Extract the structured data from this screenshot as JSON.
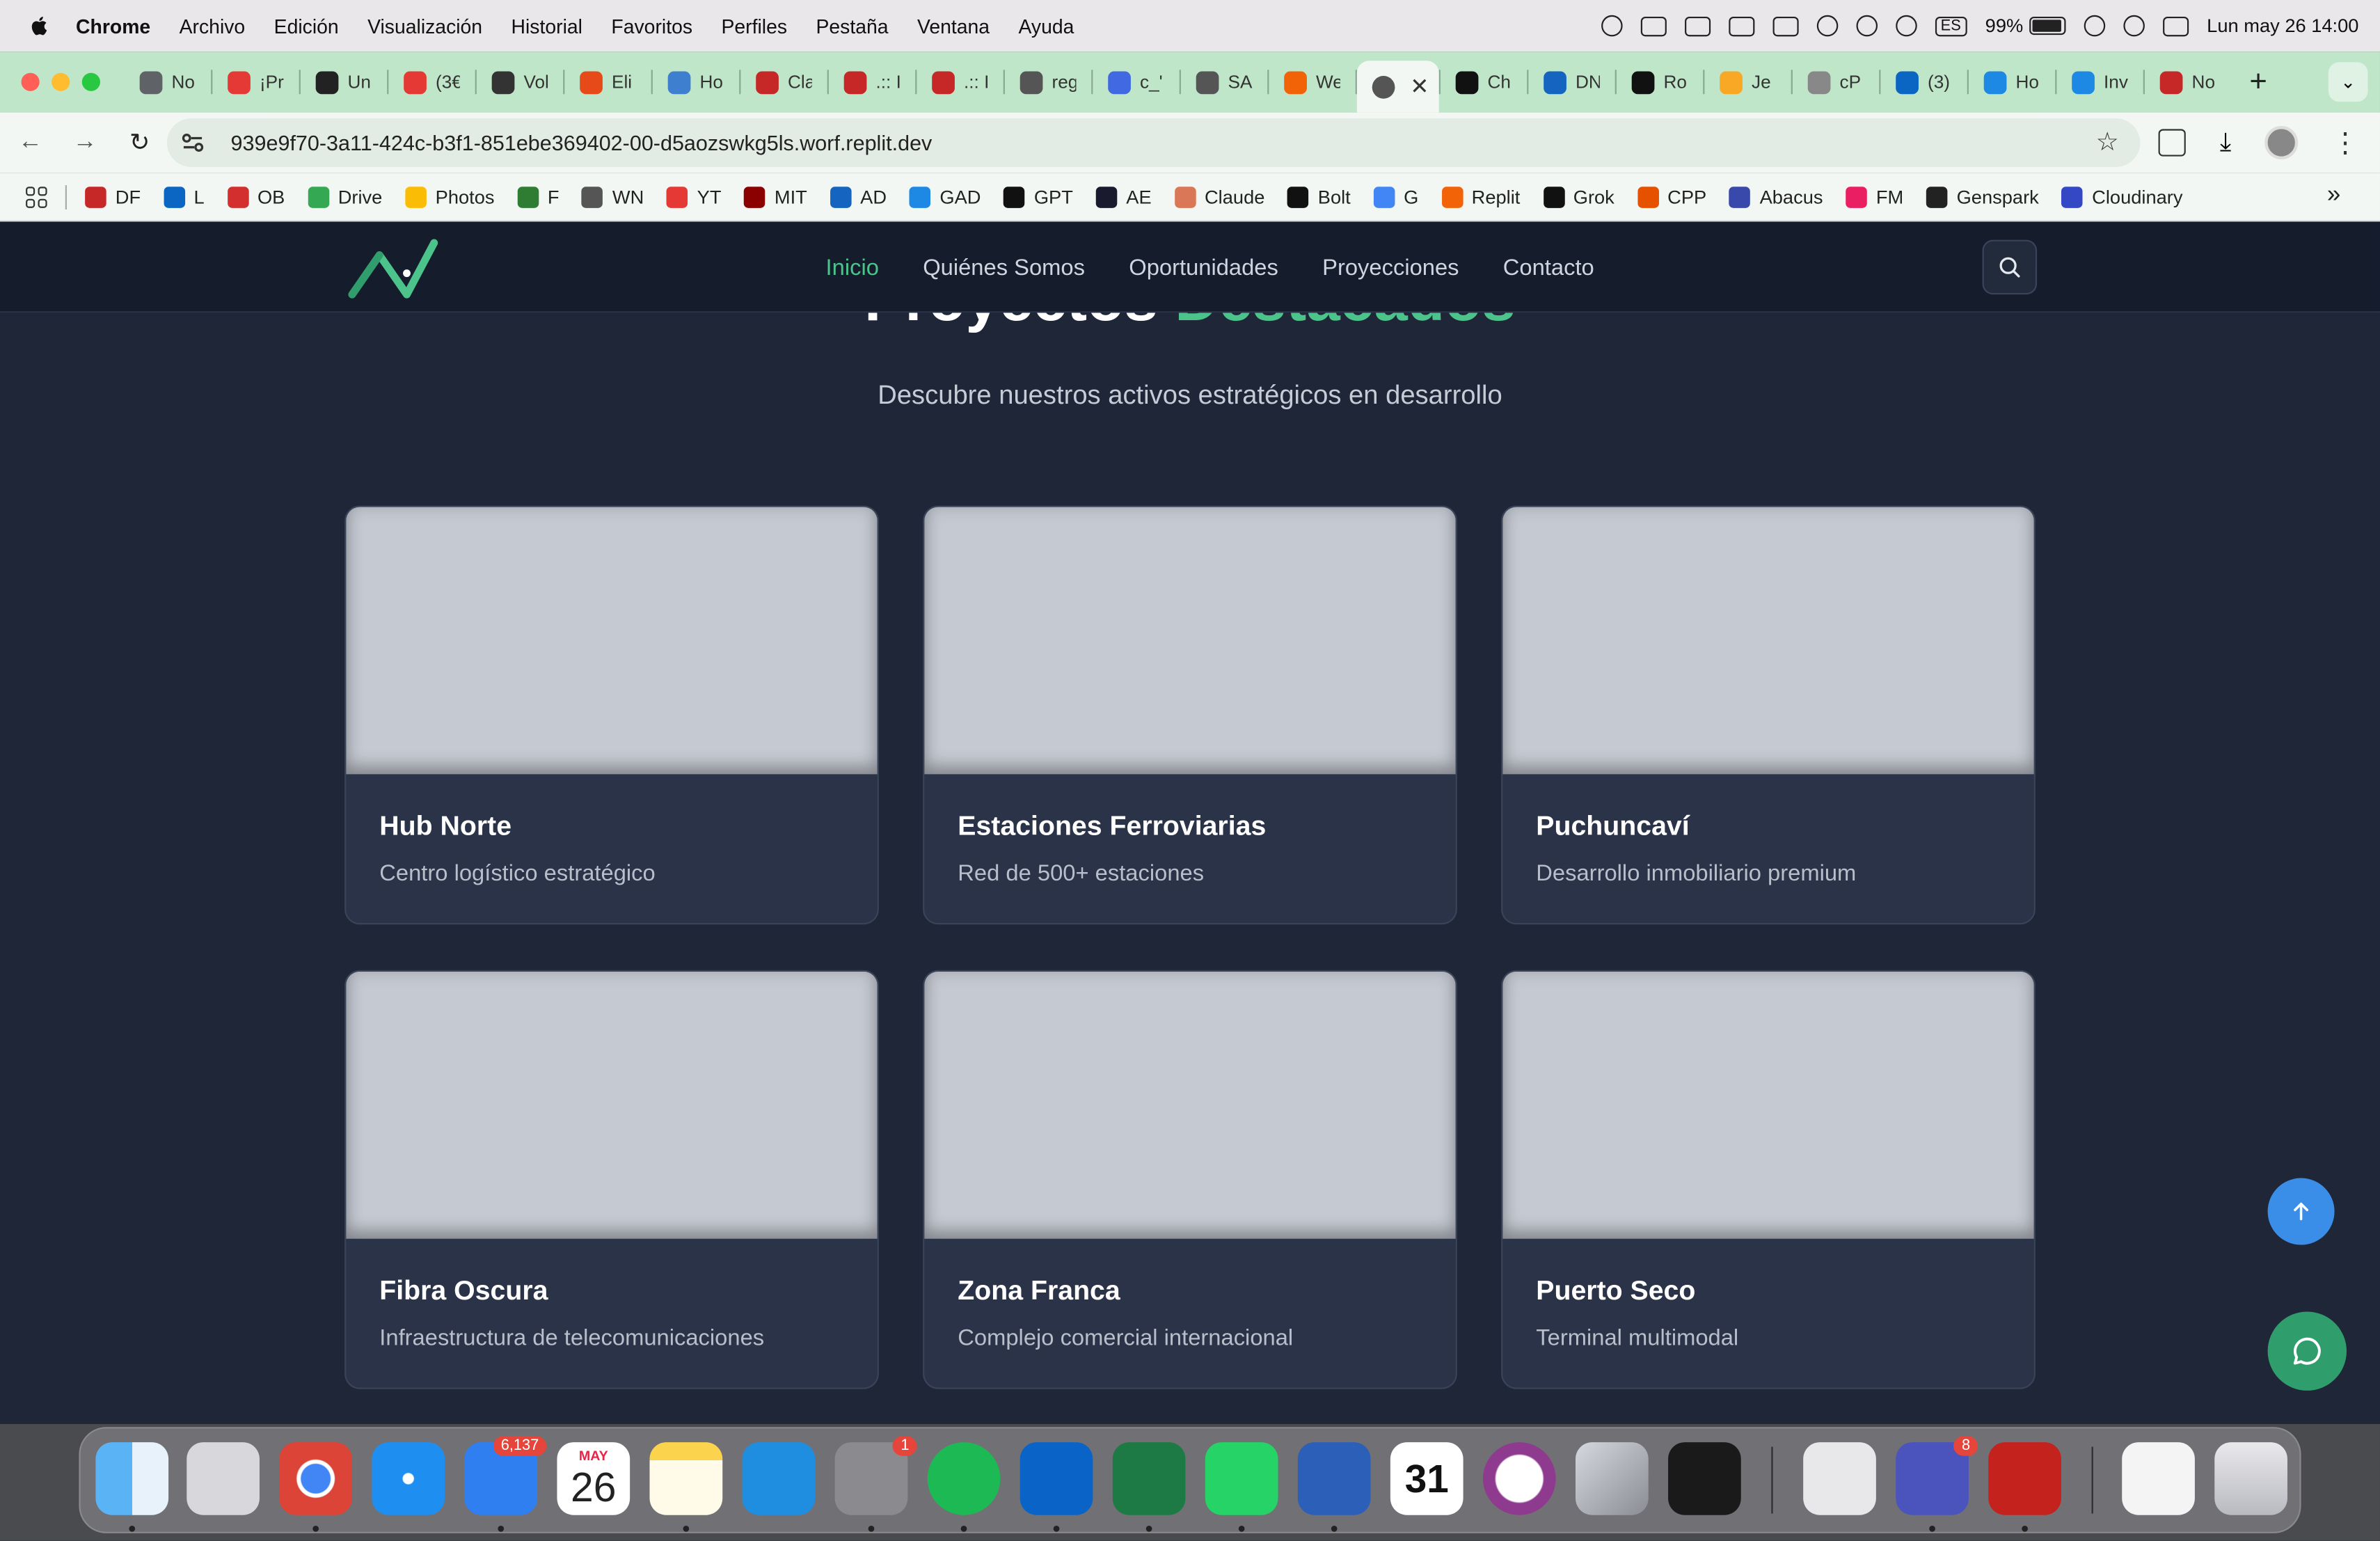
{
  "menubar": {
    "app": "Chrome",
    "items": [
      "Archivo",
      "Edición",
      "Visualización",
      "Historial",
      "Favoritos",
      "Perfiles",
      "Pestaña",
      "Ventana",
      "Ayuda"
    ],
    "input_source": "ES",
    "battery": "99%",
    "datetime": "Lun may 26  14:00"
  },
  "tabs": [
    {
      "text": "No",
      "color": "#5f6368"
    },
    {
      "text": "¡Pr",
      "color": "#e53935"
    },
    {
      "text": "Un",
      "color": "#222222"
    },
    {
      "text": "(3€",
      "color": "#e53935"
    },
    {
      "text": "Vol",
      "color": "#333333"
    },
    {
      "text": "Eli",
      "color": "#e64a19"
    },
    {
      "text": "Ho",
      "color": "#3f7fd0"
    },
    {
      "text": "Cla",
      "color": "#c62828"
    },
    {
      "text": ".:: I",
      "color": "#c62828"
    },
    {
      "text": ".:: I",
      "color": "#c62828"
    },
    {
      "text": "reg",
      "color": "#555555"
    },
    {
      "text": "c_'",
      "color": "#4169e1"
    },
    {
      "text": "SA",
      "color": "#555555"
    },
    {
      "text": "We",
      "color": "#f26207"
    },
    {
      "text": "",
      "color": "#555555",
      "active": true
    },
    {
      "text": "Ch",
      "color": "#111111"
    },
    {
      "text": "DN",
      "color": "#1565c0"
    },
    {
      "text": "Ro",
      "color": "#111111"
    },
    {
      "text": "Je",
      "color": "#f9a825"
    },
    {
      "text": "cP",
      "color": "#888888"
    },
    {
      "text": "(3)",
      "color": "#0a66c2"
    },
    {
      "text": "Ho",
      "color": "#1e88e5"
    },
    {
      "text": "Inv",
      "color": "#1e88e5"
    },
    {
      "text": "No",
      "color": "#c62828"
    }
  ],
  "address_bar": {
    "url": "939e9f70-3a11-424c-b3f1-851ebe369402-00-d5aozswkg5ls.worf.replit.dev"
  },
  "bookmarks": [
    {
      "label": "DF",
      "color": "#c62828"
    },
    {
      "label": "L",
      "color": "#0a66c2"
    },
    {
      "label": "OB",
      "color": "#d32f2f"
    },
    {
      "label": "Drive",
      "color": "#34a853"
    },
    {
      "label": "Photos",
      "color": "#fbbc05"
    },
    {
      "label": "F",
      "color": "#2e7d32"
    },
    {
      "label": "WN",
      "color": "#555555"
    },
    {
      "label": "YT",
      "color": "#e53935"
    },
    {
      "label": "MIT",
      "color": "#8b0000"
    },
    {
      "label": "AD",
      "color": "#1565c0"
    },
    {
      "label": "GAD",
      "color": "#1e88e5"
    },
    {
      "label": "GPT",
      "color": "#111111"
    },
    {
      "label": "AE",
      "color": "#1a1a2e"
    },
    {
      "label": "Claude",
      "color": "#d97757"
    },
    {
      "label": "Bolt",
      "color": "#111111"
    },
    {
      "label": "G",
      "color": "#4285f4"
    },
    {
      "label": "Replit",
      "color": "#f26207"
    },
    {
      "label": "Grok",
      "color": "#111111"
    },
    {
      "label": "CPP",
      "color": "#e65100"
    },
    {
      "label": "Abacus",
      "color": "#3949ab"
    },
    {
      "label": "FM",
      "color": "#e91e63"
    },
    {
      "label": "Genspark",
      "color": "#222222"
    },
    {
      "label": "Cloudinary",
      "color": "#3448c5"
    }
  ],
  "site": {
    "nav": {
      "links": [
        "Inicio",
        "Quiénes Somos",
        "Oportunidades",
        "Proyecciones",
        "Contacto"
      ],
      "active_index": 0
    },
    "heading_main": "Proyectos ",
    "heading_accent": "Destacados",
    "subtitle": "Descubre nuestros activos estratégicos en desarrollo",
    "cards": [
      {
        "title": "Hub Norte",
        "description": "Centro logístico estratégico"
      },
      {
        "title": "Estaciones Ferroviarias",
        "description": "Red de 500+ estaciones"
      },
      {
        "title": "Puchuncaví",
        "description": "Desarrollo inmobiliario premium"
      },
      {
        "title": "Fibra Oscura",
        "description": "Infraestructura de telecomunicaciones"
      },
      {
        "title": "Zona Franca",
        "description": "Complejo comercial internacional"
      },
      {
        "title": "Puerto Seco",
        "description": "Terminal multimodal"
      }
    ],
    "accent_color": "#4cc38a"
  },
  "dock": {
    "mail_badge": "6,137",
    "calendar_month": "MAY",
    "calendar_day": "26",
    "settings_badge": "1",
    "teams_badge": "8",
    "calendar31_label": "31"
  }
}
